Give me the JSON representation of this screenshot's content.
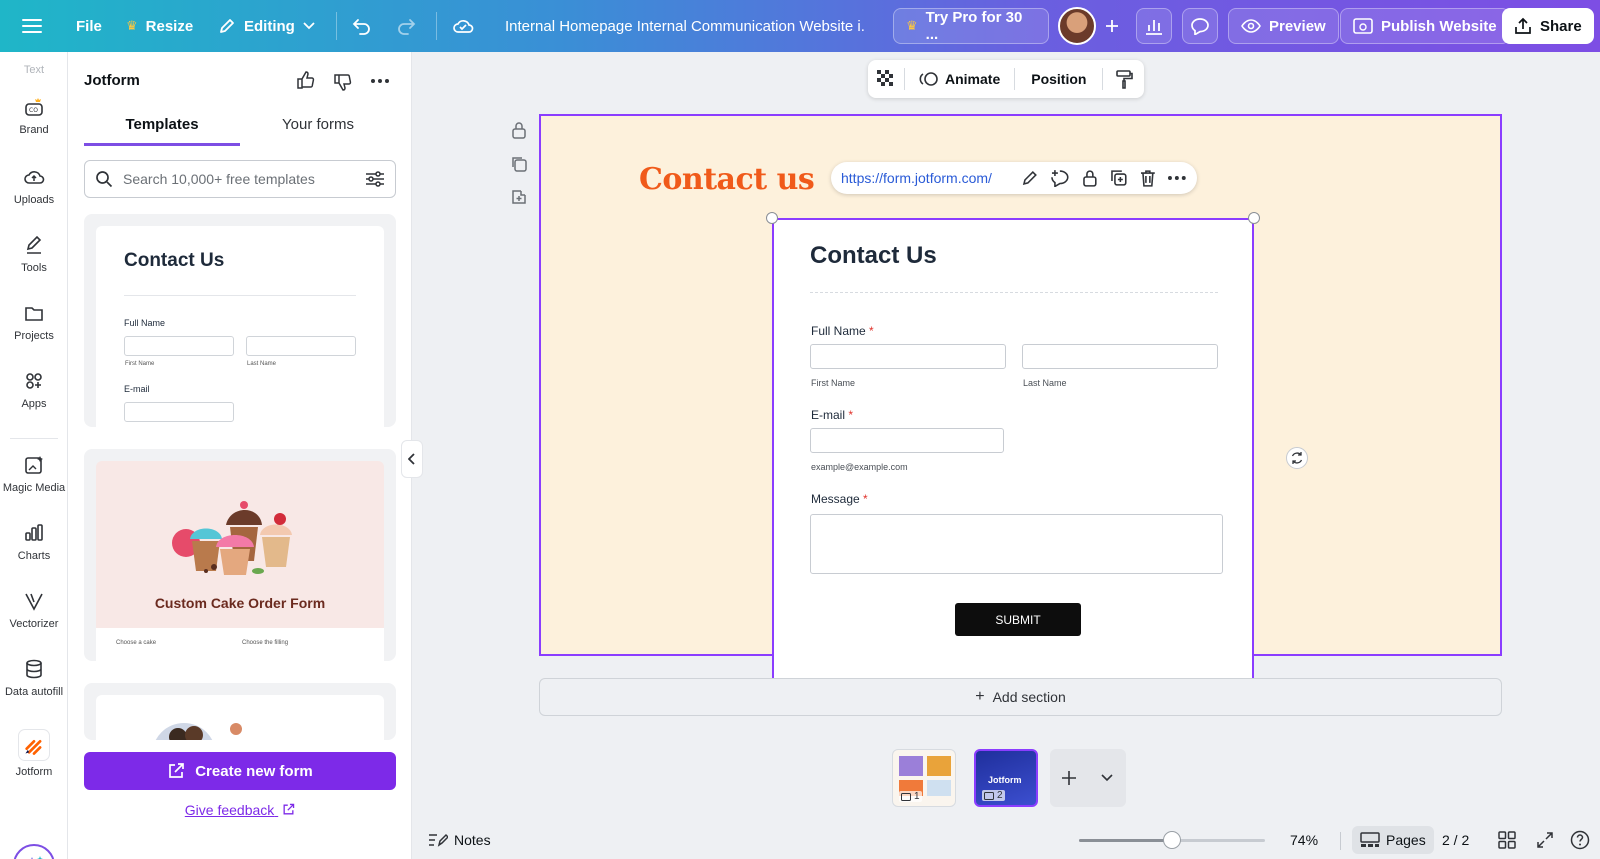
{
  "topbar": {
    "file": "File",
    "resize": "Resize",
    "editing": "Editing",
    "doc_title": "Internal Homepage Internal Communication Website i...",
    "try_pro": "Try Pro for 30 ...",
    "preview": "Preview",
    "publish": "Publish Website",
    "share": "Share"
  },
  "rail": {
    "faded_top": "Text",
    "items": [
      "Brand",
      "Uploads",
      "Tools",
      "Projects",
      "Apps",
      "Magic Media",
      "Charts",
      "Vectorizer",
      "Data autofill",
      "Jotform"
    ]
  },
  "panel": {
    "title": "Jotform",
    "tabs": [
      "Templates",
      "Your forms"
    ],
    "search_placeholder": "Search 10,000+ free templates",
    "template1": {
      "title": "Contact Us",
      "full_name": "Full Name",
      "first_name": "First Name",
      "last_name": "Last Name",
      "email": "E-mail"
    },
    "template2": {
      "title": "Custom Cake Order Form",
      "sub1": "Choose a cake",
      "sub2": "Choose the filling"
    },
    "create_button": "Create new form",
    "feedback": "Give feedback"
  },
  "context_bar": {
    "animate": "Animate",
    "position": "Position"
  },
  "canvas": {
    "heading": "Contact us",
    "url": "https://form.jotform.com/",
    "add_section": "Add section"
  },
  "form": {
    "title": "Contact Us",
    "full_name": "Full Name",
    "first_name": "First Name",
    "last_name": "Last Name",
    "email": "E-mail",
    "email_hint": "example@example.com",
    "message": "Message",
    "required_mark": "*",
    "submit": "SUBMIT"
  },
  "pages": {
    "thumb1_num": "1",
    "thumb2_num": "2",
    "thumb2_label": "Jotform"
  },
  "bottom": {
    "notes": "Notes",
    "zoom": "74%",
    "zoom_fraction": 0.5,
    "pages": "Pages",
    "page_count": "2 / 2"
  },
  "colors": {
    "accent": "#7d2ae8",
    "selection": "#8b3dff",
    "heading_orange": "#f05a1a",
    "page_bg": "#fdf1dc"
  }
}
